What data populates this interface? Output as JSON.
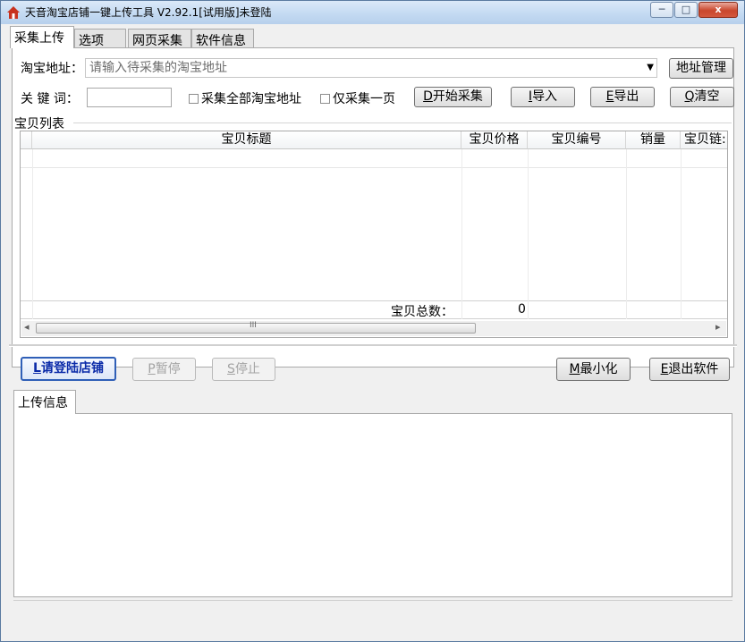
{
  "window": {
    "title": "天音淘宝店铺一键上传工具 V2.92.1[试用版]未登陆",
    "minimize_glyph": "─",
    "maximize_glyph": "□",
    "close_glyph": "x"
  },
  "tabs": [
    {
      "label": "采集上传",
      "active": true
    },
    {
      "label": "选项",
      "active": false
    },
    {
      "label": "网页采集",
      "active": false
    },
    {
      "label": "软件信息",
      "active": false
    }
  ],
  "collect": {
    "url_label": "淘宝地址：",
    "url_placeholder": "请输入待采集的淘宝地址",
    "dropdown_arrow": "▼",
    "address_manage_button": "地址管理",
    "keyword_label": "关 键 词：",
    "keyword_value": "",
    "collect_all_checkbox": "采集全部淘宝地址",
    "collect_one_page_checkbox": "仅采集一页",
    "start_collect_key": "D",
    "start_collect_text": "开始采集",
    "import_key": "I",
    "import_text": "导入",
    "export_key": "E",
    "export_text": "导出",
    "clear_key": "Q",
    "clear_text": "清空"
  },
  "list": {
    "group_label": "宝贝列表",
    "columns": [
      "宝贝标题",
      "宝贝价格",
      "宝贝编号",
      "销量",
      "宝贝链:"
    ],
    "total_label": "宝贝总数：",
    "total_value": "0",
    "scroll_left": "◂",
    "scroll_right": "▸",
    "scroll_grip": "III"
  },
  "actions": {
    "login_key": "L",
    "login_text": "请登陆店铺",
    "pause_key": "P",
    "pause_text": "暂停",
    "stop_key": "S",
    "stop_text": "停止",
    "minimize_key": "M",
    "minimize_text": "最小化",
    "exit_key": "E",
    "exit_text": "退出软件"
  },
  "upload": {
    "tab_label": "上传信息",
    "log": ""
  },
  "colors": {
    "title_bar": "#c4daf2",
    "close_button": "#c9462c",
    "primary_border": "#2f5fb7",
    "app_icon": "#c8321f"
  }
}
